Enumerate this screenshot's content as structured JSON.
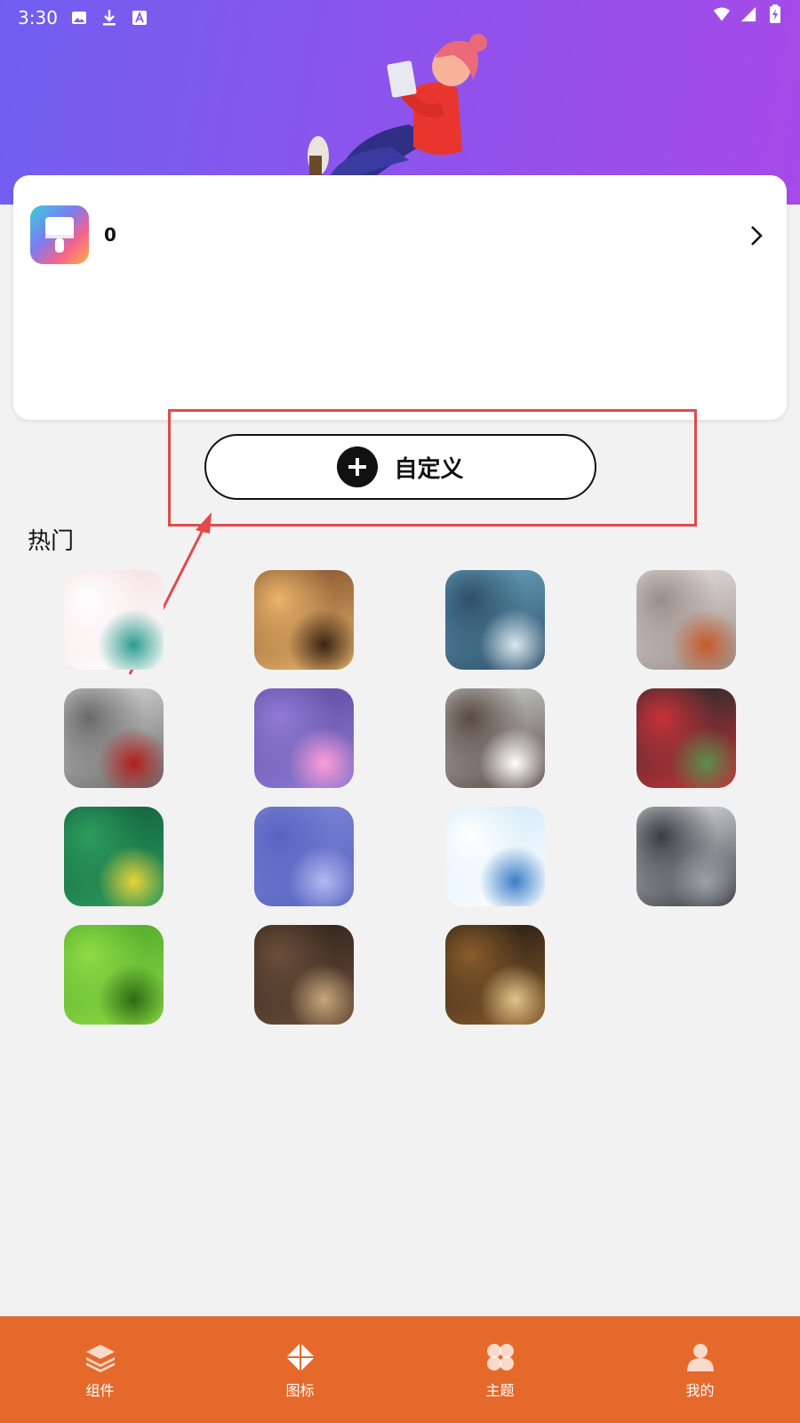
{
  "status_bar": {
    "time": "3:30",
    "icons": [
      "image-icon",
      "download-icon",
      "text-a-icon",
      "wifi-icon",
      "signal-icon",
      "battery-charging-icon"
    ]
  },
  "summary_card": {
    "count": "0"
  },
  "custom_button": {
    "label": "自定义"
  },
  "hot_section": {
    "title": "热门",
    "thumbnails": [
      {
        "name": "unicorn-thumbnail",
        "palette": [
          "#f3dde2",
          "#ffffff",
          "#2a9e8e"
        ]
      },
      {
        "name": "cozy-room-thumbnail",
        "palette": [
          "#7a4b2a",
          "#e8b36a",
          "#3a2514"
        ]
      },
      {
        "name": "girl-planet-thumbnail",
        "palette": [
          "#6aa7bf",
          "#2f4f6b",
          "#d9e7ee"
        ]
      },
      {
        "name": "winter-trees-thumbnail",
        "palette": [
          "#e8e3e1",
          "#9a8e8a",
          "#c65a2a"
        ]
      },
      {
        "name": "snow-train-thumbnail",
        "palette": [
          "#dcdcdc",
          "#6a6a6a",
          "#b3201c"
        ]
      },
      {
        "name": "purple-sky-thumbnail",
        "palette": [
          "#5b4aa0",
          "#8f7bd4",
          "#ff9dd6"
        ]
      },
      {
        "name": "snowy-village-thumbnail",
        "palette": [
          "#cfd6d8",
          "#5a4a42",
          "#ffffff"
        ]
      },
      {
        "name": "roses-pattern-thumbnail",
        "palette": [
          "#1a2a2a",
          "#c8323a",
          "#5c8f4a"
        ]
      },
      {
        "name": "forest-pool-thumbnail",
        "palette": [
          "#0f5a3a",
          "#2d9d5e",
          "#e9d43a"
        ]
      },
      {
        "name": "hydrangea-thumbnail",
        "palette": [
          "#7d88d8",
          "#5864c0",
          "#b3b9f0"
        ]
      },
      {
        "name": "sky-sketch-thumbnail",
        "palette": [
          "#cde8f8",
          "#ffffff",
          "#3b7ec7"
        ]
      },
      {
        "name": "frozen-lake-thumbnail",
        "palette": [
          "#e4e6e6",
          "#3a3d44",
          "#9aa1a7"
        ]
      },
      {
        "name": "green-leaf-thumbnail",
        "palette": [
          "#4aa42a",
          "#8edb44",
          "#2c6b13"
        ]
      },
      {
        "name": "cafe-interior-thumbnail",
        "palette": [
          "#2a1f19",
          "#6b4f3a",
          "#c9a77c"
        ]
      },
      {
        "name": "gramophone-thumbnail",
        "palette": [
          "#1d1712",
          "#8a5c2c",
          "#e3c48a"
        ]
      }
    ]
  },
  "bottom_nav": {
    "items": [
      {
        "label": "组件",
        "icon": "layers-icon"
      },
      {
        "label": "图标",
        "icon": "diamond-icon"
      },
      {
        "label": "主题",
        "icon": "clover-icon"
      },
      {
        "label": "我的",
        "icon": "person-icon"
      }
    ]
  },
  "colors": {
    "header_gradient_start": "#6f5ff0",
    "header_gradient_end": "#a64ae8",
    "nav_background": "#e5692b",
    "annotation_red": "#e04a4a",
    "page_background": "#f2f2f2"
  }
}
